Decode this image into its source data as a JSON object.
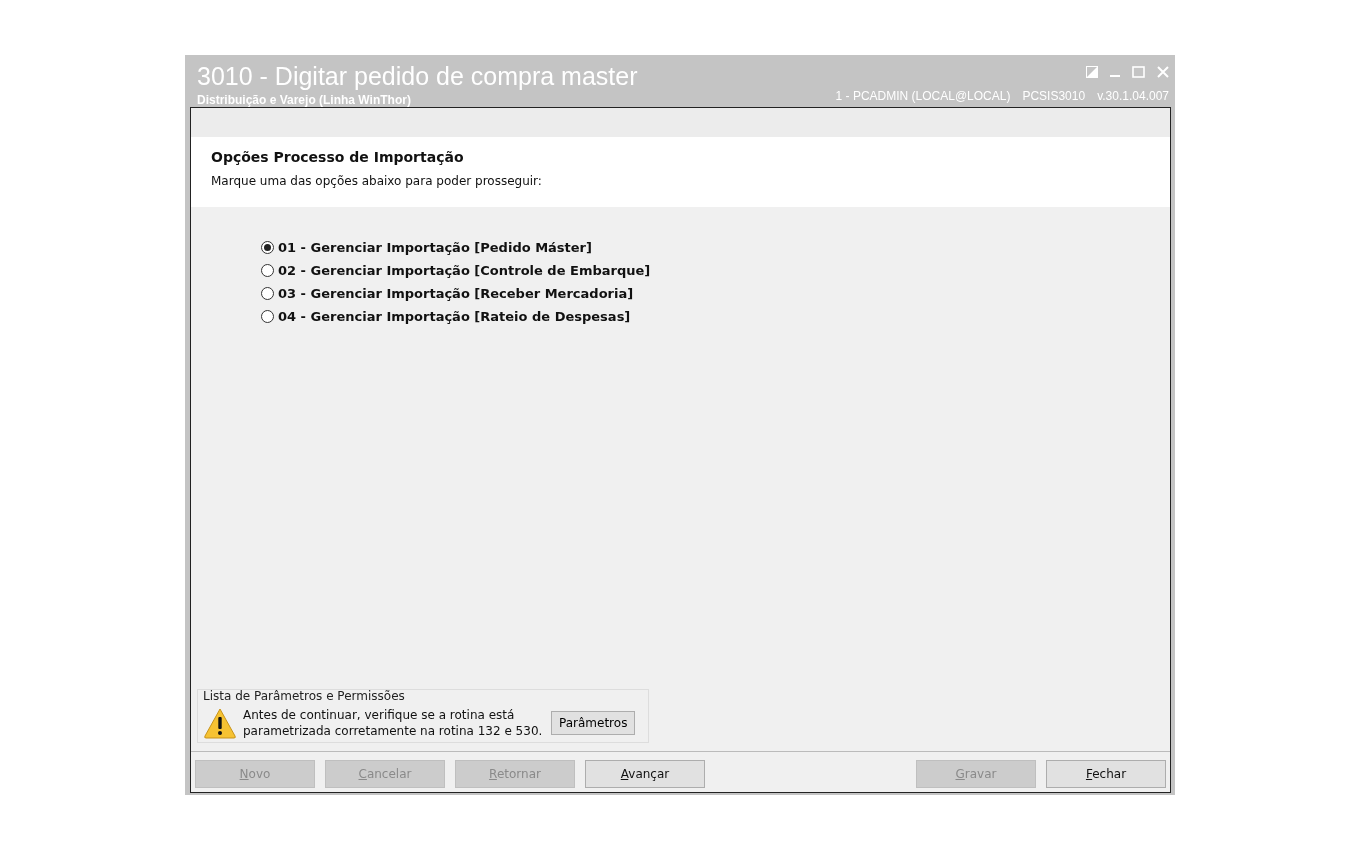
{
  "window": {
    "title": "3010 - Digitar pedido de compra master",
    "subtitle": "Distribuição e Varejo (Linha WinThor)",
    "user": "1 - PCADMIN (LOCAL@LOCAL)",
    "module": "PCSIS3010",
    "version": "v.30.1.04.007"
  },
  "header": {
    "title": "Opções Processo de Importação",
    "instruction": "Marque uma das opções abaixo para poder prosseguir:"
  },
  "options": [
    {
      "label": "01 - Gerenciar Importação [Pedido Máster]",
      "selected": true
    },
    {
      "label": "02 - Gerenciar Importação [Controle de Embarque]",
      "selected": false
    },
    {
      "label": "03 - Gerenciar Importação [Receber Mercadoria]",
      "selected": false
    },
    {
      "label": "04 - Gerenciar Importação [Rateio de Despesas]",
      "selected": false
    }
  ],
  "parameters_group": {
    "legend": "Lista de Parâmetros e Permissões",
    "message": "Antes de continuar, verifique se a rotina está parametrizada corretamente na rotina 132 e 530.",
    "button": "Parâmetros"
  },
  "footer_buttons_left": [
    {
      "label": "Novo",
      "disabled": true
    },
    {
      "label": "Cancelar",
      "disabled": true
    },
    {
      "label": "Retornar",
      "disabled": true
    },
    {
      "label": "Avançar",
      "disabled": false
    }
  ],
  "footer_buttons_right": [
    {
      "label": "Gravar",
      "disabled": true
    },
    {
      "label": "Fechar",
      "disabled": false
    }
  ]
}
